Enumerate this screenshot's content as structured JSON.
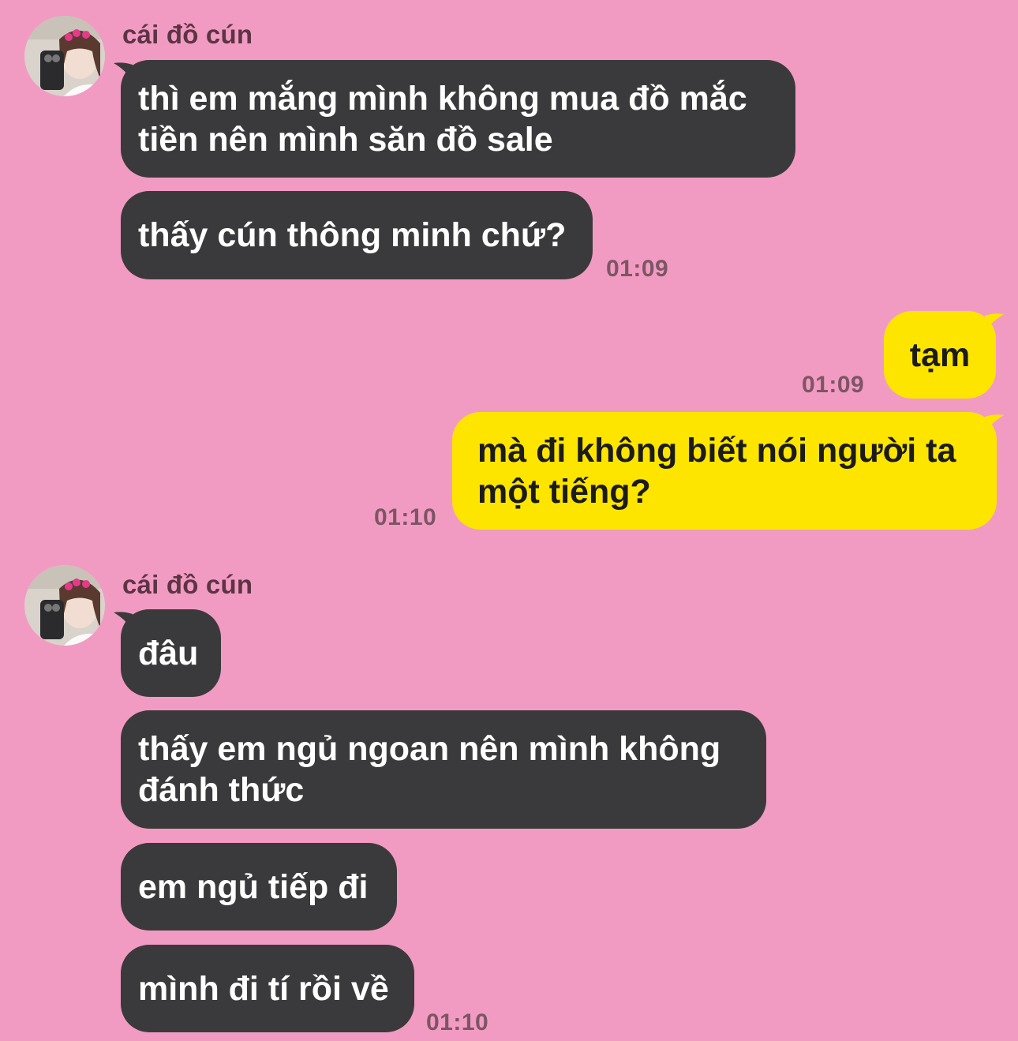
{
  "groups": [
    {
      "sender": "cái đồ cún",
      "messages": [
        "thì em mắng mình không mua đồ mắc tiền nên mình săn đồ sale",
        "thấy cún thông minh chứ?"
      ],
      "time": "01:09"
    },
    {
      "sender": "cái đồ cún",
      "messages": [
        "đâu",
        "thấy em ngủ ngoan nên mình không đánh thức",
        "em ngủ tiếp đi",
        "mình đi tí rồi về"
      ],
      "time": "01:10"
    }
  ],
  "outgoing": [
    {
      "text": "tạm",
      "time": "01:09"
    },
    {
      "text": "mà đi không biết nói người ta một tiếng?",
      "time": "01:10"
    }
  ],
  "colors": {
    "background": "#F29BC2",
    "incoming_bubble": "#3A3A3C",
    "outgoing_bubble": "#FEE500"
  },
  "icons": [
    "avatar-photo",
    "bubble-tail"
  ]
}
